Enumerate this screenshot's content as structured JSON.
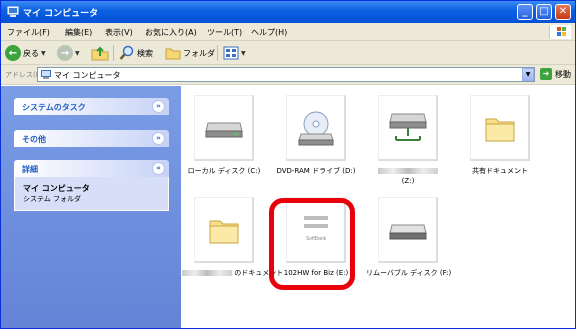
{
  "window": {
    "title": "マイ コンピュータ"
  },
  "menu": {
    "items": [
      "ファイル(F)",
      "編集(E)",
      "表示(V)",
      "お気に入り(A)",
      "ツール(T)",
      "ヘルプ(H)"
    ]
  },
  "toolbar": {
    "back_label": "戻る",
    "search_label": "検索",
    "folders_label": "フォルダ"
  },
  "address": {
    "label": "アドレス(D)",
    "value": "マイ コンピュータ",
    "go_label": "移動"
  },
  "taskpane": {
    "system_tasks_title": "システムのタスク",
    "other_title": "その他",
    "details_title": "詳細",
    "details_name": "マイ コンピュータ",
    "details_type": "システム フォルダ"
  },
  "drives": [
    {
      "label": "ローカル ディスク (C:)",
      "icon": "hard-disk-icon"
    },
    {
      "label": "DVD-RAM ドライブ (D:)",
      "icon": "dvd-drive-icon"
    },
    {
      "label": "(Z:)",
      "icon": "network-drive-icon"
    },
    {
      "label": "共有ドキュメント",
      "icon": "folder-icon"
    },
    {
      "label": "のドキュメント",
      "icon": "folder-icon"
    },
    {
      "label": "102HW for Biz (E:)",
      "icon": "softbank-device-icon",
      "brand": "SoftBank"
    },
    {
      "label": "リムーバブル ディスク (F:)",
      "icon": "removable-disk-icon"
    }
  ],
  "colors": {
    "title_bar": "#0a5fe0",
    "highlight": "#e8000b",
    "task_pane": "#7a9de6"
  }
}
